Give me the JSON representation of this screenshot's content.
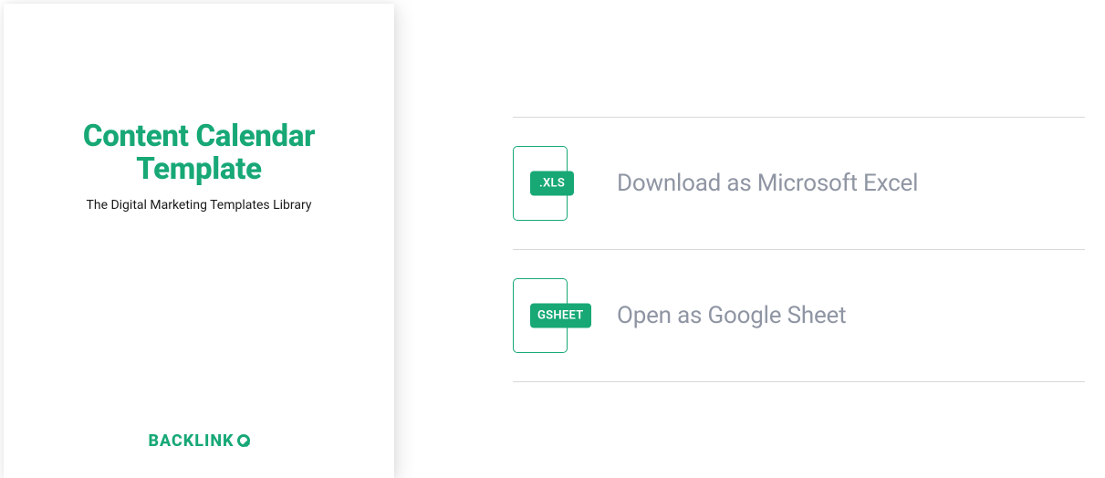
{
  "card": {
    "title_line1": "Content Calendar",
    "title_line2": "Template",
    "subtitle": "The Digital Marketing Templates Library",
    "logo_text": "BACKLINK"
  },
  "downloads": {
    "excel": {
      "badge": ".XLS",
      "label": "Download as Microsoft Excel"
    },
    "gsheet": {
      "badge": "GSHEET",
      "label": "Open as Google Sheet"
    }
  }
}
